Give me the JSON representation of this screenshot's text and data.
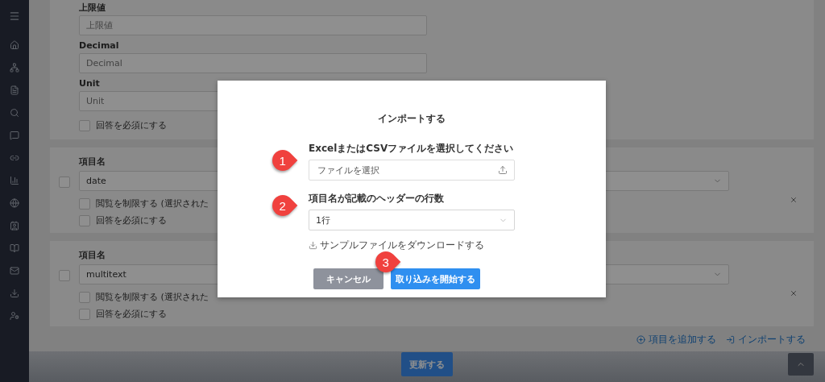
{
  "upper_card": {
    "fields": [
      {
        "label": "上限値",
        "placeholder": "上限値"
      },
      {
        "label": "Decimal",
        "placeholder": "Decimal"
      },
      {
        "label": "Unit",
        "placeholder": "Unit"
      }
    ],
    "required": {
      "label": "回答を必須にする",
      "checked": false
    }
  },
  "item_cards": [
    {
      "label": "項目名",
      "value": "date",
      "checked": false,
      "restrict": {
        "label": "閲覧を制限する (選択された",
        "checked": false
      },
      "required": {
        "label": "回答を必須にする",
        "checked": false
      }
    },
    {
      "label": "項目名",
      "value": "multitext",
      "checked": false,
      "restrict": {
        "label": "閲覧を制限する (選択された",
        "checked": false
      },
      "required": {
        "label": "回答を必須にする",
        "checked": false
      }
    }
  ],
  "actions": [
    {
      "kind": "add",
      "label": "項目を追加する"
    },
    {
      "kind": "import",
      "label": "インポートする"
    }
  ],
  "footer": {
    "button": "更新する"
  },
  "modal": {
    "title": "インポートする",
    "file_label": "ExcelまたはCSVファイルを選択してください",
    "file_placeholder": "ファイルを選択",
    "rows_label": "項目名が記載のヘッダーの行数",
    "rows_value": "1行",
    "download": "サンプルファイルをダウンロードする",
    "cancel": "キャンセル",
    "start": "取り込みを開始する"
  },
  "markers": [
    "1",
    "2",
    "3"
  ]
}
